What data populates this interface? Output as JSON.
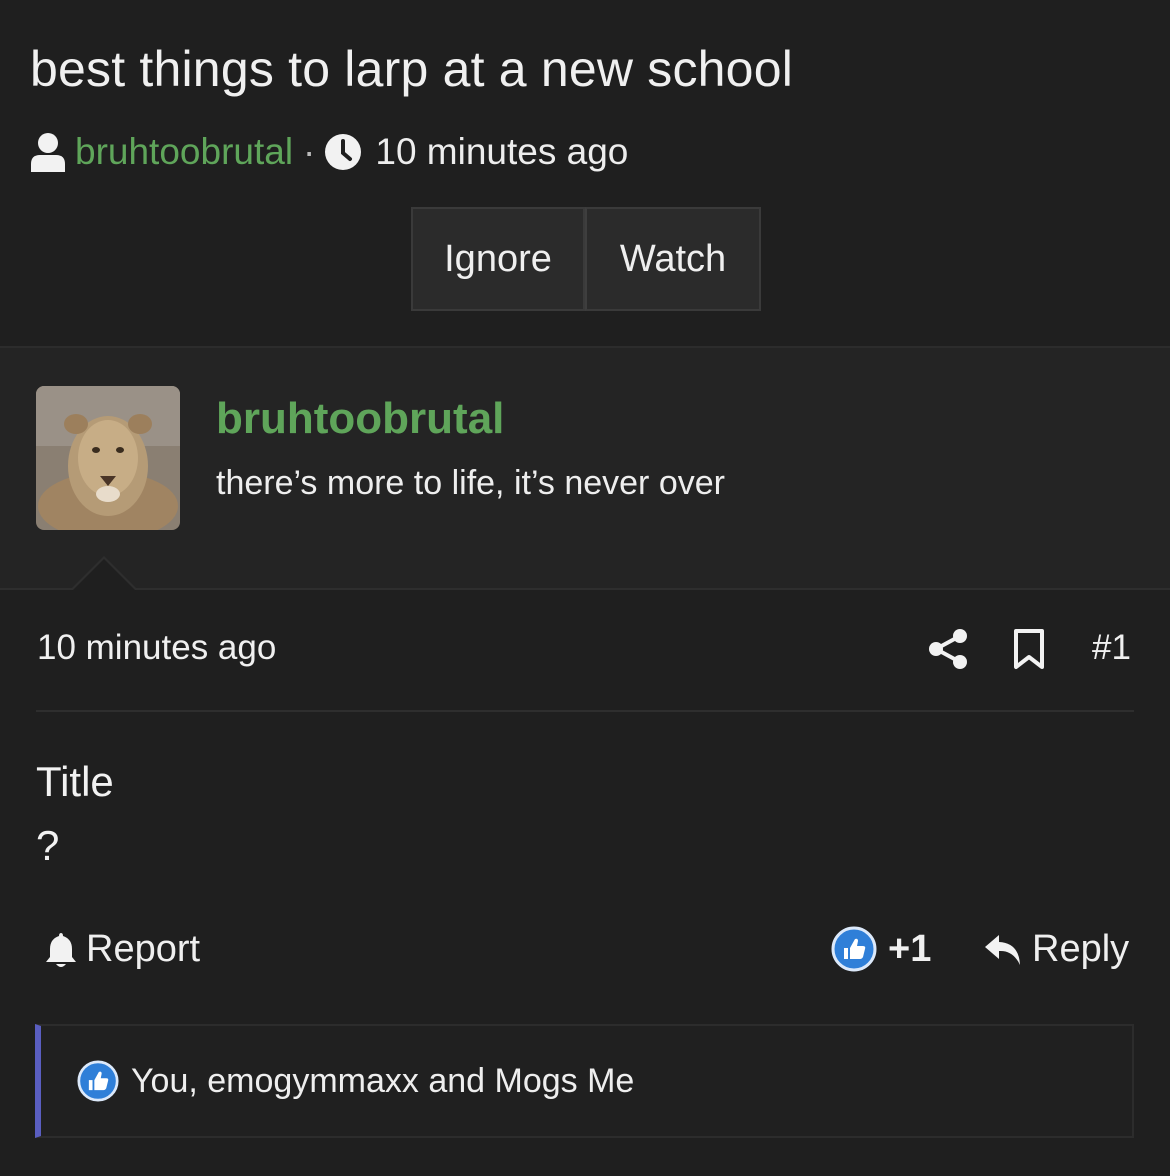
{
  "thread": {
    "title": "best things to larp at a new school",
    "author": "bruhtoobrutal",
    "separator": "·",
    "time": "10 minutes ago"
  },
  "actions": {
    "ignore_label": "Ignore",
    "watch_label": "Watch"
  },
  "author_card": {
    "name": "bruhtoobrutal",
    "status": "there’s more to life, it’s never over",
    "avatar_icon": "lion-avatar"
  },
  "post": {
    "time": "10 minutes ago",
    "number": "#1",
    "body_title": "Title",
    "body_text": "?",
    "report_label": "Report",
    "like_count": "+1",
    "reply_label": "Reply",
    "likes_summary": "You, emogymmaxx and Mogs Me"
  },
  "colors": {
    "background": "#1f1f1f",
    "username_green": "#5fa55a",
    "like_blue": "#2f7fd8",
    "likes_bar_accent": "#5a5ec0"
  }
}
